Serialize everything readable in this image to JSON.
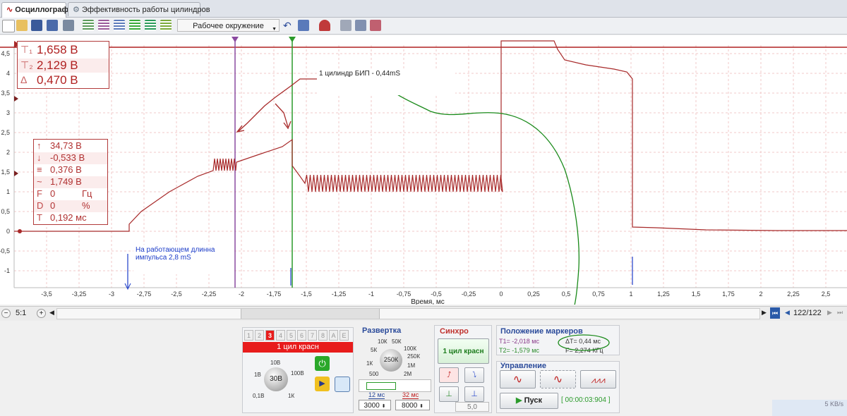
{
  "tabs": [
    {
      "label": "Осциллограф",
      "icon": "wave-icon",
      "active": true
    },
    {
      "label": "Эффективность работы цилиндров",
      "icon": "gear-icon",
      "active": false
    }
  ],
  "toolbar": {
    "environment": "Рабочее окружение"
  },
  "plot": {
    "y_ticks": [
      "4,5",
      "4",
      "3,5",
      "3",
      "2,5",
      "2",
      "1,5",
      "1",
      "0,5",
      "0",
      "-0,5",
      "-1"
    ],
    "x_ticks": [
      "-3,5",
      "-3,25",
      "-3",
      "-2,75",
      "-2,5",
      "-2,25",
      "-2",
      "-1,75",
      "-1,5",
      "-1,25",
      "-1",
      "-0,75",
      "-0,5",
      "-0,25",
      "0",
      "0,25",
      "0,5",
      "0,75",
      "1",
      "1,25",
      "1,5",
      "1,75",
      "2",
      "2,25",
      "2,5"
    ],
    "x_label": "Время, мс",
    "annotation_top": "1 цилиндр  БИП - 0,44mS",
    "annotation_bottom_1": "На работающем длинна",
    "annotation_bottom_2": "импульса 2,8 mS",
    "colors": {
      "signal": "#a82a2a",
      "marker1": "#8a4aa0",
      "marker2": "#2a9a2a",
      "hand": "#1a8a1a",
      "blue": "#1c3cc8"
    }
  },
  "markers_box": {
    "rows": [
      {
        "icon": "T1",
        "value": "1,658 В"
      },
      {
        "icon": "T2",
        "value": "2,129 В"
      },
      {
        "icon": "Δ",
        "value": "0,470 В"
      }
    ]
  },
  "stats_box": {
    "rows": [
      {
        "icon": "max-arrow-icon",
        "value": "34,73 В",
        "unit": ""
      },
      {
        "icon": "min-arrow-icon",
        "value": "-0,533 В",
        "unit": ""
      },
      {
        "icon": "avg-icon",
        "value": "0,376 В",
        "unit": ""
      },
      {
        "icon": "rms-icon",
        "value": "1,749 В",
        "unit": ""
      },
      {
        "icon": "F",
        "value": "0",
        "unit": "Гц"
      },
      {
        "icon": "D",
        "value": "0",
        "unit": "%"
      },
      {
        "icon": "T",
        "value": "0,192 мс",
        "unit": ""
      }
    ]
  },
  "scroll": {
    "zoom": "5:1",
    "page": "122/122"
  },
  "channels": {
    "tabs": [
      "1",
      "2",
      "3",
      "4",
      "5",
      "6",
      "7",
      "8",
      "A",
      "E"
    ],
    "active_index": 2,
    "active_label": "1 цил красн",
    "knob_value": "30В",
    "knob_labels": [
      "10В",
      "100В",
      "1В",
      "1К",
      "0,1В"
    ]
  },
  "sweep": {
    "title": "Развертка",
    "knob_value": "250К",
    "labels": [
      "10К",
      "50К",
      "100К",
      "5К",
      "250К",
      "1К",
      "1М",
      "500",
      "2М"
    ],
    "range_left": "12 мс",
    "range_right": "32 мс",
    "input_left": "3000",
    "input_right": "8000"
  },
  "sync": {
    "title": "Синхро",
    "source": "1 цил красн",
    "level": "5,0"
  },
  "marker_pos": {
    "title": "Положение маркеров",
    "t1": "T1= -2,018 мс",
    "t2": "T2= -1,579 мс",
    "dt": "ΔT= 0,44 мс",
    "freq": "F= 2,274 КГц"
  },
  "control": {
    "title": "Управление",
    "start_label": "Пуск",
    "timer": "[ 00:00:03:904 ]"
  },
  "status": {
    "speed": "5 KB/s"
  }
}
